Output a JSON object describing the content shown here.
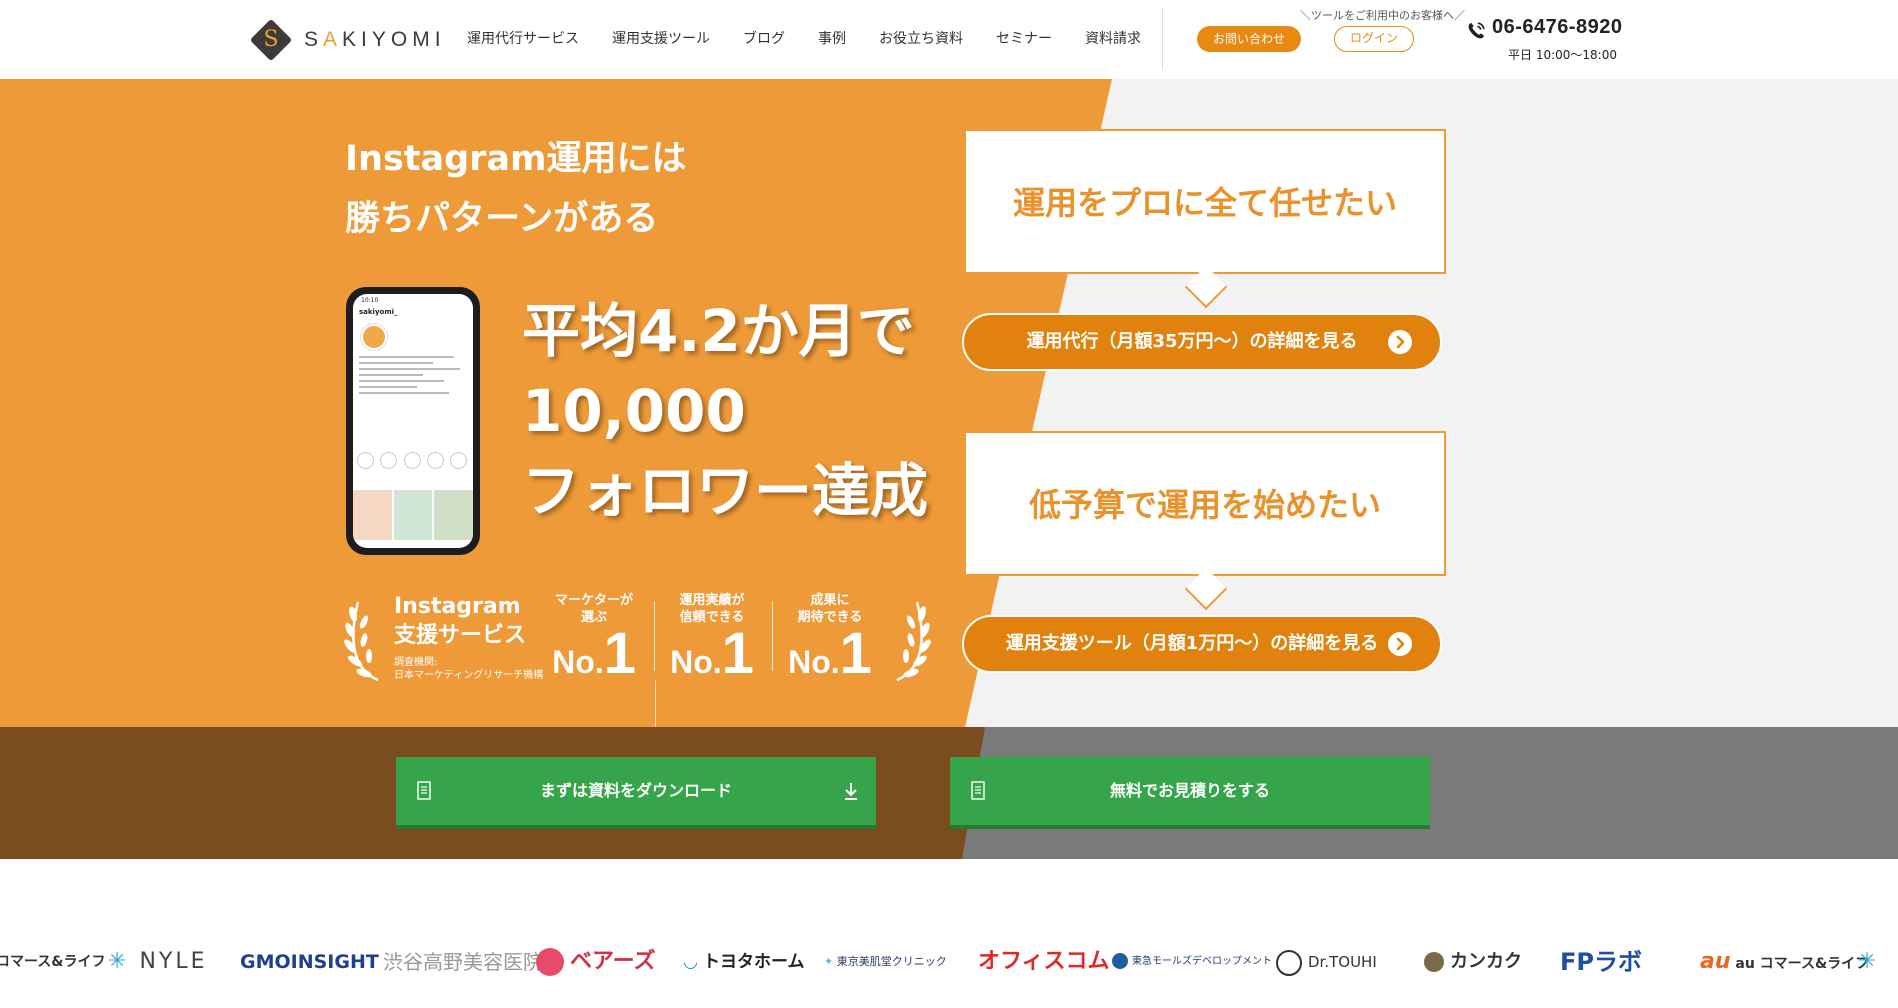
{
  "header": {
    "logo_text_s": "S",
    "logo_text_a": "A",
    "logo_text_rest": "KIYOMI",
    "nav": [
      "運用代行サービス",
      "運用支援ツール",
      "ブログ",
      "事例",
      "お役立ち資料",
      "セミナー",
      "資料請求"
    ],
    "tool_note": "＼ツールをご利用中のお客様へ／",
    "contact_label": "お問い合わせ",
    "login_label": "ログイン",
    "phone_number": "06-6476-8920",
    "phone_hours": "平日 10:00〜18:00"
  },
  "hero": {
    "title_line1": "Instagram運用には",
    "title_line2": "勝ちパターンがある",
    "main_line1": "平均4.2か月で",
    "main_line2": "10,000",
    "main_line3": "フォロワー達成",
    "phone": {
      "time": "10:10",
      "username": "sakiyomi_"
    },
    "award": {
      "service_line1": "Instagram",
      "service_line2": "支援サービス",
      "survey_line1": "調査機関:",
      "survey_line2": "日本マーケティングリサーチ機構",
      "columns": [
        {
          "caption_line1": "マーケターが",
          "caption_line2": "選ぶ",
          "no": "No.",
          "one": "1"
        },
        {
          "caption_line1": "運用実績が",
          "caption_line2": "信頼できる",
          "no": "No.",
          "one": "1"
        },
        {
          "caption_line1": "成果に",
          "caption_line2": "期待できる",
          "no": "No.",
          "one": "1"
        }
      ]
    },
    "card1_text": "運用をプロに全て任せたい",
    "pill1_label": "運用代行（月額35万円〜）の詳細を見る",
    "card2_text": "低予算で運用を始めたい",
    "pill2_label": "運用支援ツール（月額1万円〜）の詳細を見る"
  },
  "band": {
    "download_label": "まずは資料をダウンロード",
    "estimate_label": "無料でお見積りをする"
  },
  "logos": [
    "コマース&ライフ",
    "NYLE",
    "GMOINSIGHT",
    "渋谷高野美容医院",
    "ベアーズ",
    "トヨタホーム",
    "東京美肌堂クリニック",
    "オフィスコム",
    "東急モールズデベロップメント",
    "Dr.TOUHI",
    "カンカク",
    "FPラボ",
    "au コマース&ライフ"
  ],
  "colors": {
    "orange": "#ee9a38",
    "orange_dark": "#e0820d",
    "green": "#36a44a",
    "brown": "#7b4d1e"
  }
}
